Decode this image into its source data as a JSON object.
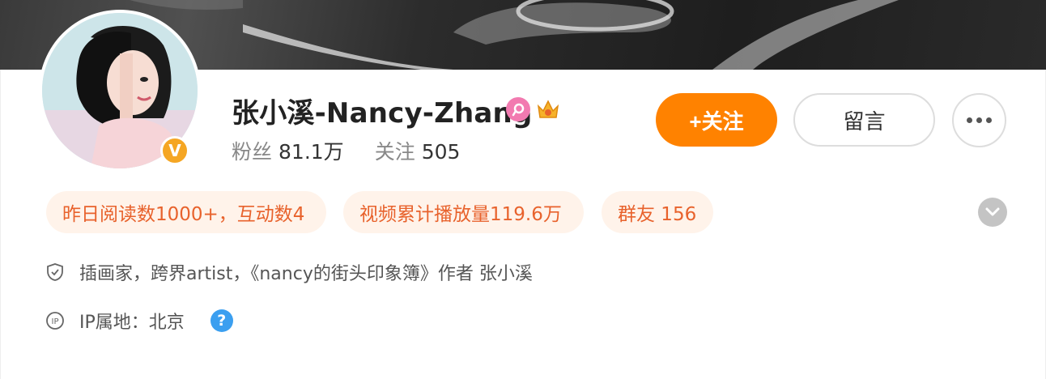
{
  "profile": {
    "username": "张小溪-Nancy-Zhang",
    "verified_mark": "V",
    "stats": {
      "fans_label": "粉丝",
      "fans_value": "81.1万",
      "following_label": "关注",
      "following_value": "505"
    }
  },
  "actions": {
    "follow_label": "+关注",
    "message_label": "留言"
  },
  "tags": [
    "昨日阅读数1000+，互动数4",
    "视频累计播放量119.6万",
    "群友 156"
  ],
  "info": {
    "bio": "插画家，跨界artist，《nancy的街头印象簿》作者 张小溪",
    "ip": "IP属地：北京",
    "help_mark": "?"
  },
  "colors": {
    "accent": "#ff8200",
    "tag_bg": "#fff3ea",
    "tag_text": "#e8622c",
    "verified": "#f5a623",
    "vip": "#f27ab0",
    "help": "#3b9ff0"
  },
  "icons": {
    "vip": "vip-icon",
    "crown": "crown-icon",
    "more": "more-dots-icon",
    "expand": "chevron-down-icon",
    "bio": "shield-icon",
    "ip": "ip-icon",
    "help": "help-icon"
  }
}
